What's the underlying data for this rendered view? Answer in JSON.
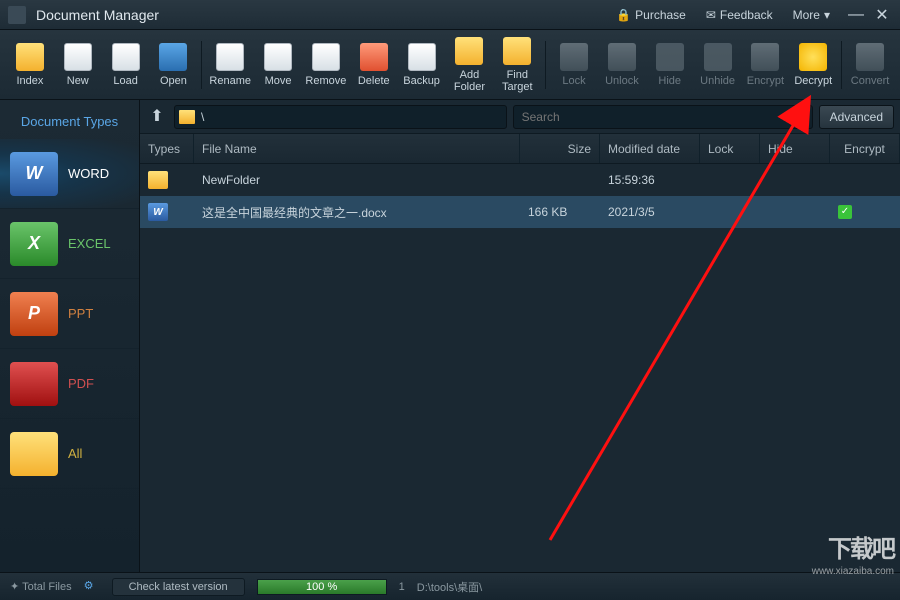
{
  "title": "Document Manager",
  "top_buttons": {
    "purchase": "Purchase",
    "feedback": "Feedback",
    "more": "More"
  },
  "toolbar": {
    "index": "Index",
    "new": "New",
    "load": "Load",
    "open": "Open",
    "rename": "Rename",
    "move": "Move",
    "remove": "Remove",
    "delete": "Delete",
    "backup": "Backup",
    "addfolder": "Add Folder",
    "findtarget": "Find Target",
    "lock": "Lock",
    "unlock": "Unlock",
    "hide": "Hide",
    "unhide": "Unhide",
    "encrypt": "Encrypt",
    "decrypt": "Decrypt",
    "convert": "Convert"
  },
  "sidebar": {
    "heading": "Document Types",
    "types": [
      {
        "label": "WORD",
        "glyph": "W"
      },
      {
        "label": "EXCEL",
        "glyph": "X"
      },
      {
        "label": "PPT",
        "glyph": "P"
      },
      {
        "label": "PDF",
        "glyph": ""
      },
      {
        "label": "All",
        "glyph": ""
      }
    ]
  },
  "pathbar": {
    "path": "\\",
    "search_placeholder": "Search",
    "advanced": "Advanced"
  },
  "columns": {
    "types": "Types",
    "name": "File Name",
    "size": "Size",
    "modified": "Modified date",
    "lock": "Lock",
    "hide": "Hide",
    "encrypt": "Encrypt"
  },
  "rows": [
    {
      "kind": "folder",
      "name": "NewFolder",
      "size": "",
      "modified": "15:59:36",
      "encrypt": false
    },
    {
      "kind": "word",
      "name": "这是全中国最经典的文章之一.docx",
      "size": "166 KB",
      "modified": "2021/3/5",
      "encrypt": true
    }
  ],
  "status": {
    "total_files": "Total Files",
    "check": "Check latest version",
    "progress": "100 %",
    "count": "1",
    "path": "D:\\tools\\桌面\\"
  },
  "watermark": {
    "brand": "下载吧",
    "url": "www.xiazaiba.com"
  }
}
